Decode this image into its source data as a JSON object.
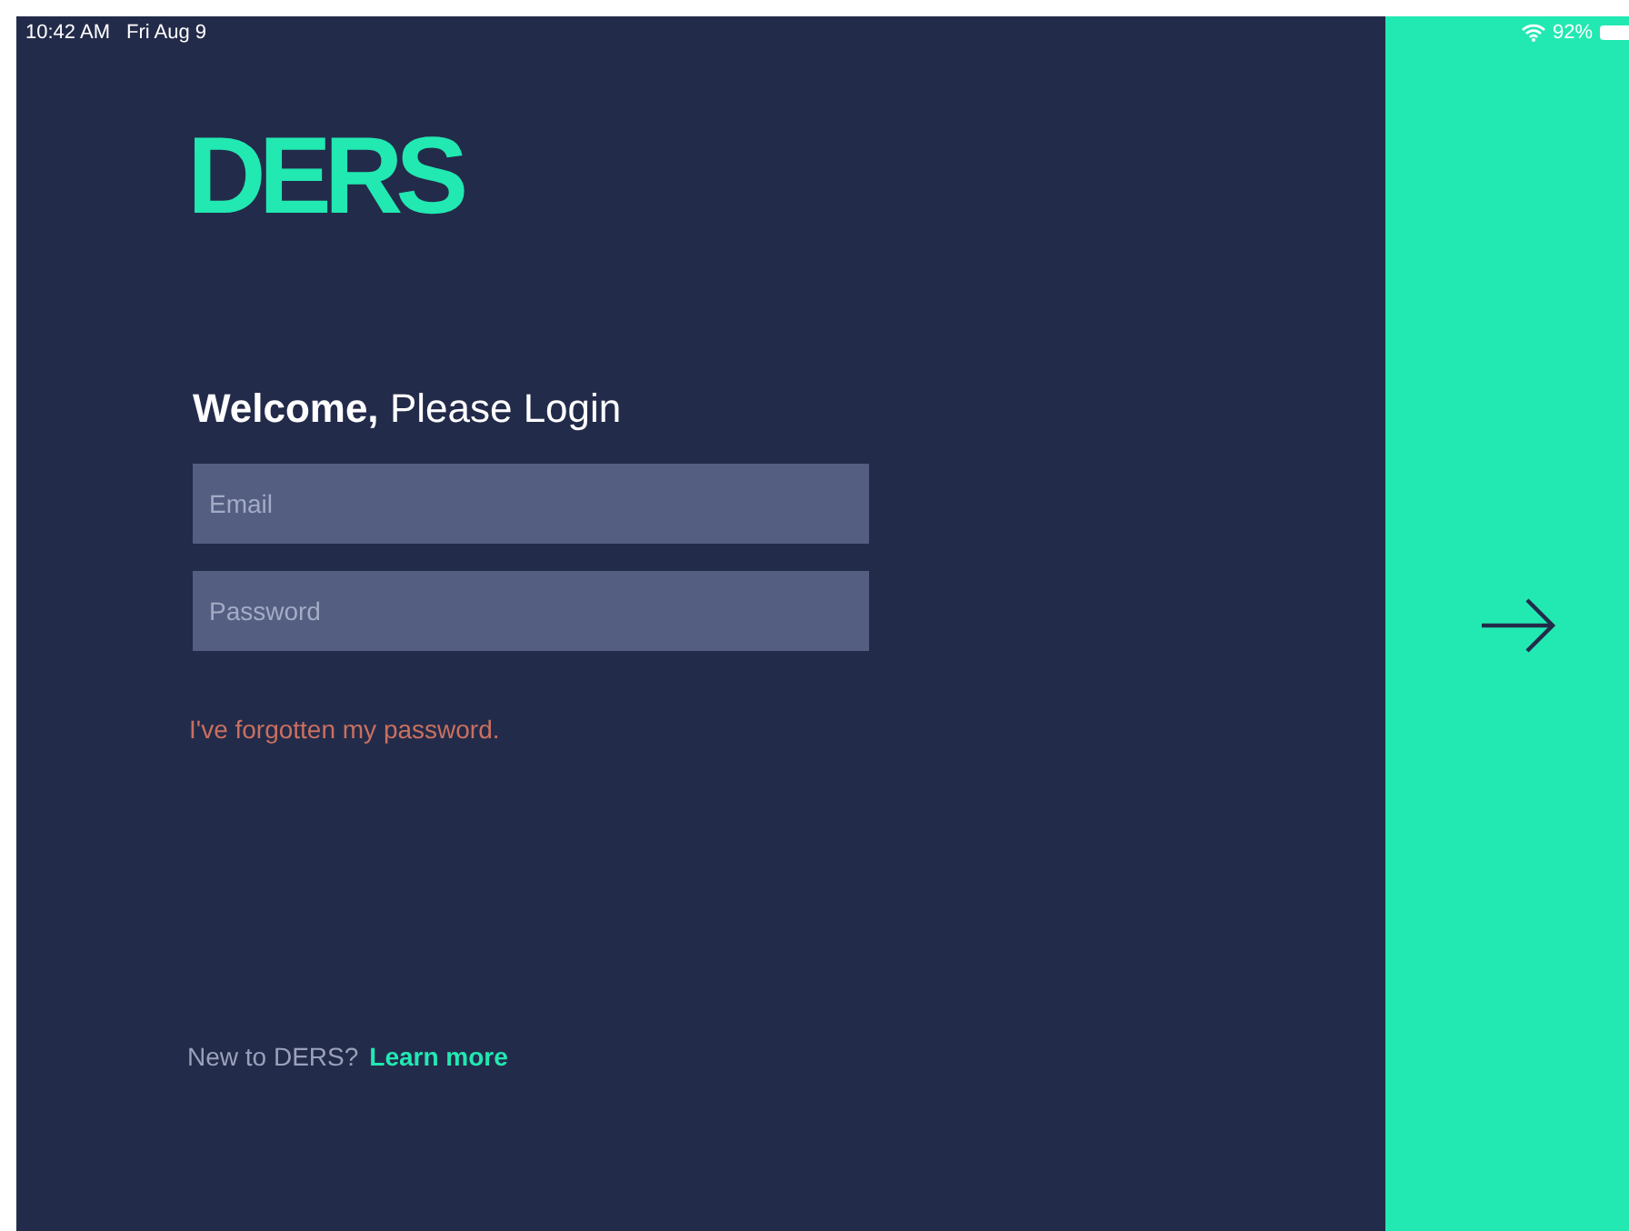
{
  "status_bar": {
    "time": "10:42 AM",
    "date": "Fri Aug 9",
    "battery": "92%"
  },
  "logo": {
    "text": "DERS"
  },
  "heading": {
    "bold": "Welcome,",
    "rest": "Please Login"
  },
  "fields": [
    {
      "placeholder": "Email"
    },
    {
      "placeholder": "Password"
    }
  ],
  "forgot_link": "I've forgotten my password.",
  "footer": {
    "text": "New to DERS?",
    "link": "Learn more"
  }
}
